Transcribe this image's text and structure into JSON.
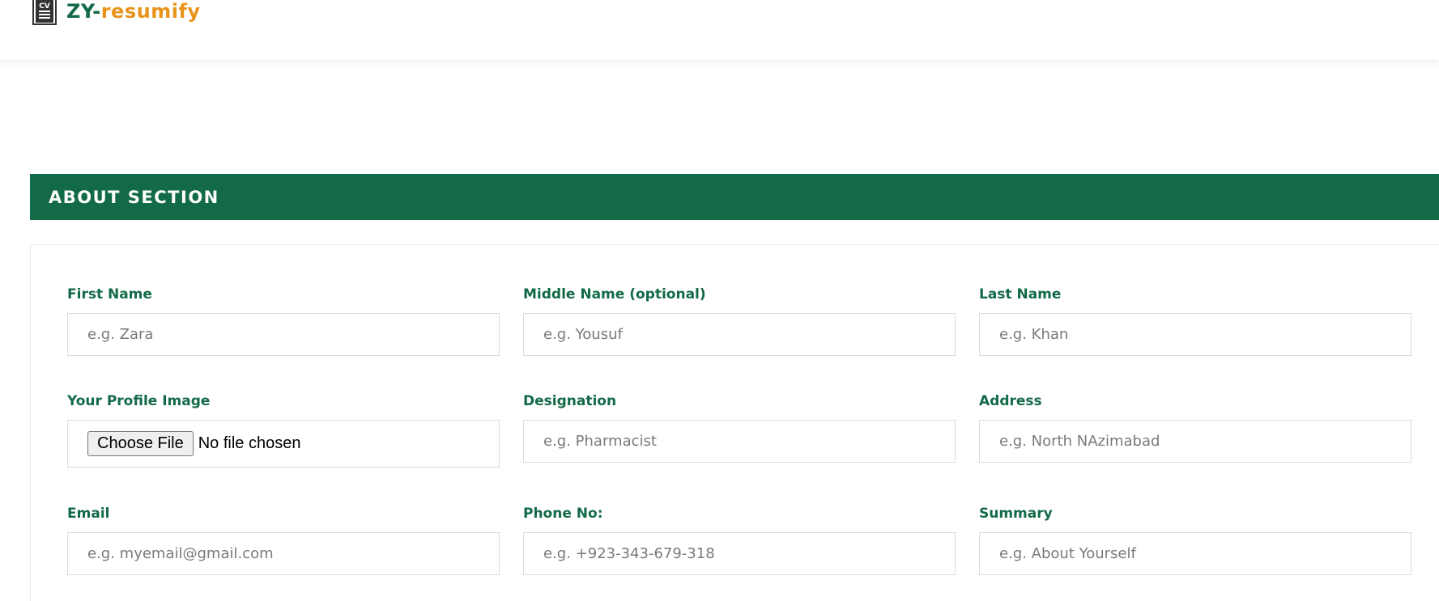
{
  "brand": {
    "icon": "cv-document-icon",
    "part1": "ZY-",
    "part2": "resumify",
    "color_primary": "#136a47",
    "color_accent": "#e8941b"
  },
  "section": {
    "title": "ABOUT SECTION",
    "background": "#136a47"
  },
  "form": {
    "first_name": {
      "label": "First Name",
      "placeholder": "e.g. Zara",
      "value": ""
    },
    "middle_name": {
      "label": "Middle Name (optional)",
      "placeholder": "e.g. Yousuf",
      "value": ""
    },
    "last_name": {
      "label": "Last Name",
      "placeholder": "e.g. Khan",
      "value": ""
    },
    "profile_image": {
      "label": "Your Profile Image",
      "button_label": "Choose File",
      "status": "No file chosen"
    },
    "designation": {
      "label": "Designation",
      "placeholder": "e.g. Pharmacist",
      "value": ""
    },
    "address": {
      "label": "Address",
      "placeholder": "e.g. North NAzimabad",
      "value": ""
    },
    "email": {
      "label": "Email",
      "placeholder": "e.g. myemail@gmail.com",
      "value": ""
    },
    "phone": {
      "label": "Phone No:",
      "placeholder": "e.g. +923-343-679-318",
      "value": ""
    },
    "summary": {
      "label": "Summary",
      "placeholder": "e.g. About Yourself",
      "value": ""
    }
  }
}
